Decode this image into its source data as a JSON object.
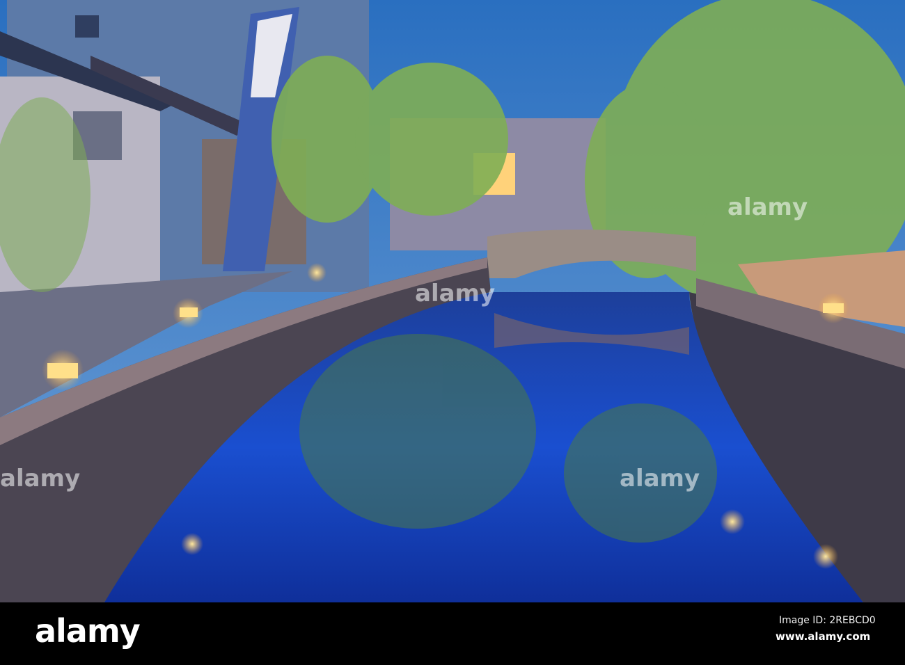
{
  "photo": {
    "subject": "canal-with-willows-at-dusk"
  },
  "watermark": {
    "brand": "alamy"
  },
  "footer": {
    "logo": "alamy",
    "image_id": "Image ID: 2REBCD0",
    "website": "www.alamy.com"
  }
}
